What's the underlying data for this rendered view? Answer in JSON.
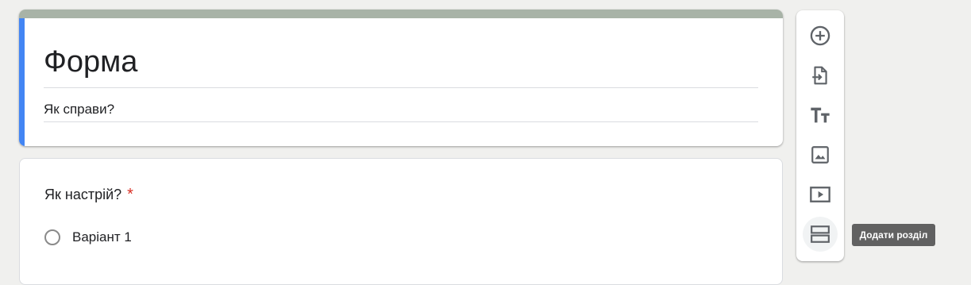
{
  "form": {
    "title": "Форма",
    "description": "Як справи?",
    "colors": {
      "header_bar": "#a8b3a7",
      "accent": "#4285f4"
    }
  },
  "question": {
    "title": "Як настрій?",
    "required_mark": "*",
    "options": [
      "Варіант 1"
    ]
  },
  "toolbar": {
    "buttons": [
      {
        "icon": "add-circle-icon"
      },
      {
        "icon": "import-questions-icon"
      },
      {
        "icon": "title-text-icon"
      },
      {
        "icon": "image-icon"
      },
      {
        "icon": "video-icon"
      },
      {
        "icon": "section-icon",
        "hovered": true
      }
    ],
    "tooltip": "Додати розділ"
  }
}
